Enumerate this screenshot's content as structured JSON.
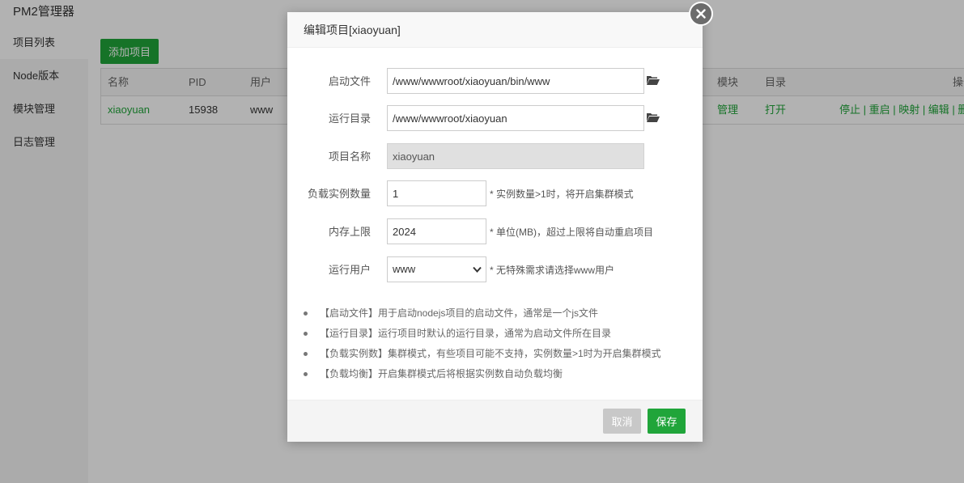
{
  "app": {
    "title": "PM2管理器"
  },
  "sidebar": {
    "items": [
      {
        "label": "项目列表"
      },
      {
        "label": "Node版本"
      },
      {
        "label": "模块管理"
      },
      {
        "label": "日志管理"
      }
    ]
  },
  "toolbar": {
    "add_label": "添加项目"
  },
  "table": {
    "headers": {
      "name": "名称",
      "pid": "PID",
      "user": "用户",
      "module": "模块",
      "dir": "目录",
      "ops": "操作"
    },
    "rows": [
      {
        "name": "xiaoyuan",
        "pid": "15938",
        "user": "www",
        "module": "管理",
        "dir": "打开",
        "ops": "停止 | 重启 | 映射 | 编辑 | 删除"
      }
    ]
  },
  "dialog": {
    "title": "编辑项目[xiaoyuan]",
    "fields": {
      "start_file": {
        "label": "启动文件",
        "value": "/www/wwwroot/xiaoyuan/bin/www"
      },
      "run_dir": {
        "label": "运行目录",
        "value": "/www/wwwroot/xiaoyuan"
      },
      "project_name": {
        "label": "项目名称",
        "value": "xiaoyuan"
      },
      "instances": {
        "label": "负载实例数量",
        "value": "1",
        "hint": "* 实例数量>1时，将开启集群模式"
      },
      "memory": {
        "label": "内存上限",
        "value": "2024",
        "hint": "* 单位(MB)，超过上限将自动重启项目"
      },
      "run_user": {
        "label": "运行用户",
        "value": "www",
        "hint": "* 无特殊需求请选择www用户"
      }
    },
    "tips": [
      "【启动文件】用于启动nodejs项目的启动文件，通常是一个js文件",
      "【运行目录】运行项目时默认的运行目录，通常为启动文件所在目录",
      "【负载实例数】集群模式，有些项目可能不支持，实例数量>1时为开启集群模式",
      "【负载均衡】开启集群模式后将根据实例数自动负载均衡"
    ],
    "cancel_label": "取消",
    "save_label": "保存"
  },
  "colors": {
    "accent": "#20a53a",
    "cancel": "#c8c8c8",
    "overlay": "rgba(0,0,0,0.3)"
  },
  "icons": {
    "folder": "folder-open-icon",
    "close": "close-icon",
    "chevron": "chevron-down-icon"
  }
}
